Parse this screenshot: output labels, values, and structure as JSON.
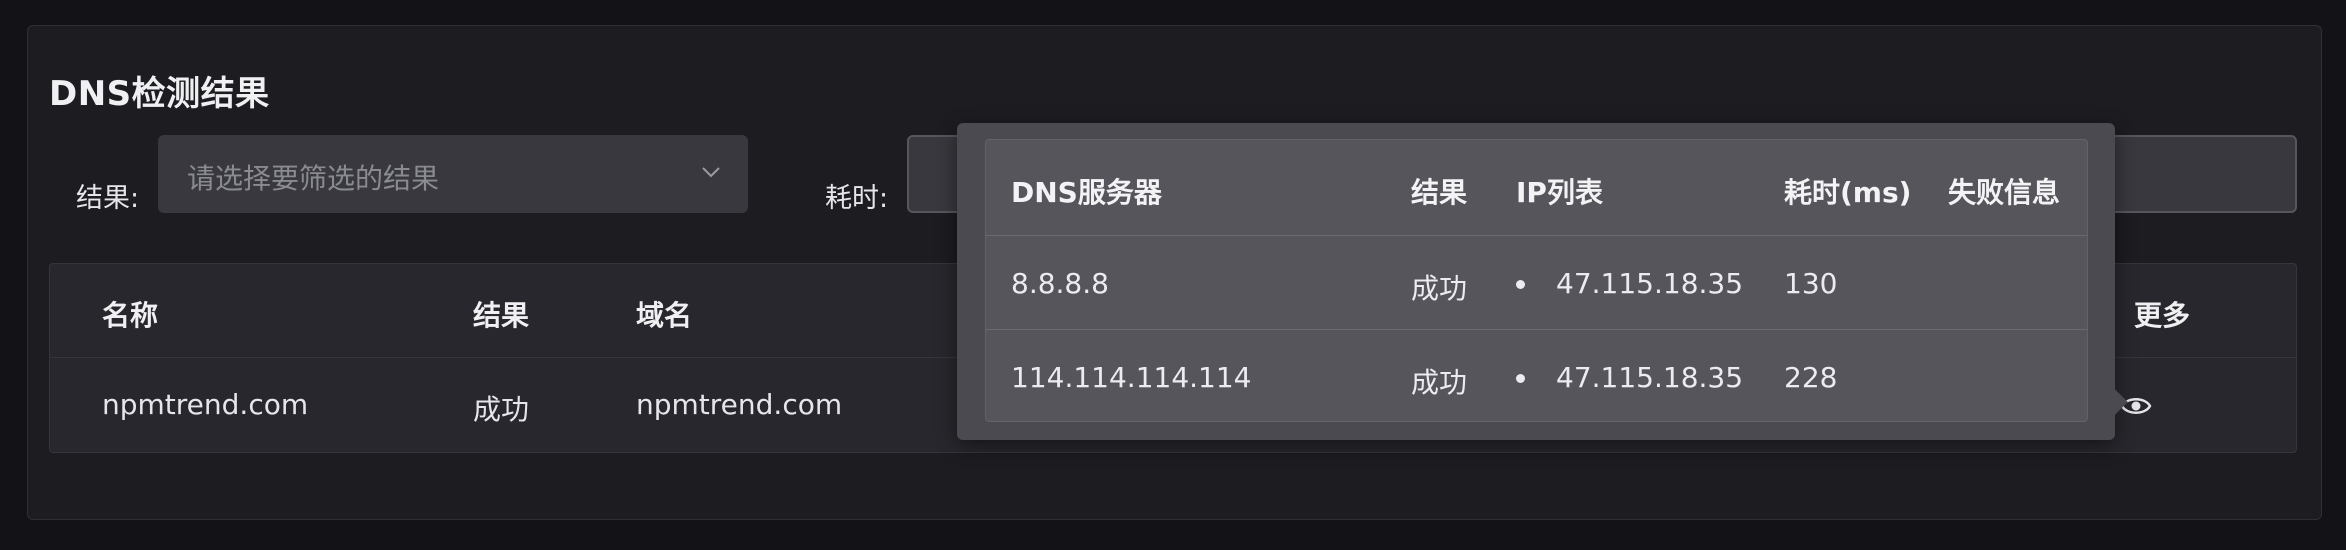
{
  "title": "DNS检测结果",
  "filters": {
    "result_label": "结果:",
    "result_placeholder": "请选择要筛选的结果",
    "time_label": "耗时:"
  },
  "table": {
    "headers": {
      "name": "名称",
      "result": "结果",
      "domain": "域名",
      "more": "更多"
    },
    "rows": [
      {
        "name": "npmtrend.com",
        "result": "成功",
        "domain": "npmtrend.com"
      }
    ]
  },
  "popover": {
    "headers": {
      "server": "DNS服务器",
      "result": "结果",
      "ip_list": "IP列表",
      "time": "耗时(ms)",
      "error": "失败信息"
    },
    "rows": [
      {
        "server": "8.8.8.8",
        "result": "成功",
        "ip": "47.115.18.35",
        "time": "130",
        "error": ""
      },
      {
        "server": "114.114.114.114",
        "result": "成功",
        "ip": "47.115.18.35",
        "time": "228",
        "error": ""
      }
    ]
  },
  "icons": {
    "select_chevron": "chevron-down-icon",
    "more": "eye-icon"
  }
}
